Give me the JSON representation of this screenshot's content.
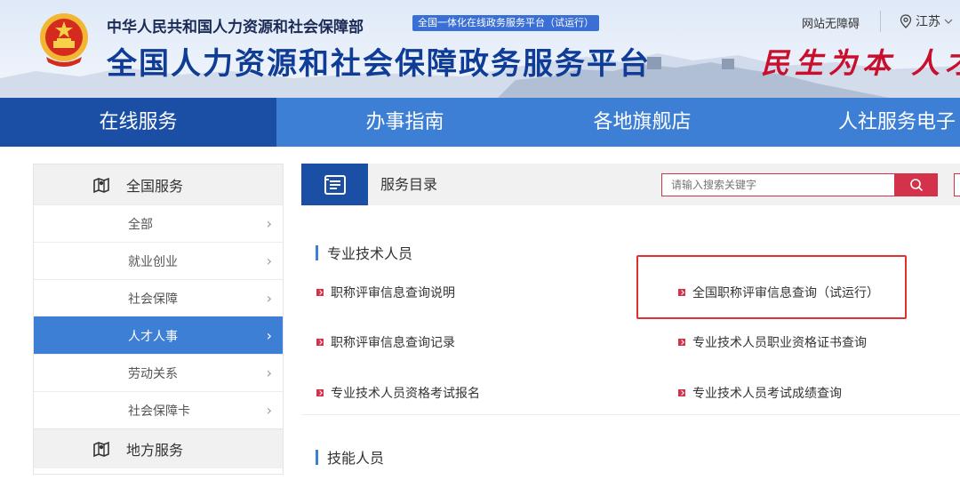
{
  "header": {
    "org_name": "中华人民共和国人力资源和社会保障部",
    "beta_badge": "全国一体化在线政务服务平台（试运行）",
    "site_title": "全国人力资源和社会保障政务服务平台",
    "barrier_free": "网站无障碍",
    "location": "江苏",
    "slogan": "民生为本 人才",
    "emblem_icon": "national-emblem-icon",
    "location_icon": "map-pin-icon"
  },
  "nav": {
    "items": [
      {
        "label": "在线服务",
        "active": true
      },
      {
        "label": "办事指南",
        "active": false
      },
      {
        "label": "各地旗舰店",
        "active": false
      },
      {
        "label": "人社服务电子",
        "active": false
      }
    ]
  },
  "sidebar": {
    "national_label": "全国服务",
    "local_label": "地方服务",
    "items": [
      {
        "label": "全部",
        "active": false
      },
      {
        "label": "就业创业",
        "active": false
      },
      {
        "label": "社会保障",
        "active": false
      },
      {
        "label": "人才人事",
        "active": true
      },
      {
        "label": "劳动关系",
        "active": false
      },
      {
        "label": "社会保障卡",
        "active": false
      }
    ]
  },
  "main": {
    "title": "服务目录",
    "search_placeholder": "请输入搜索关键字",
    "categories": [
      {
        "title": "专业技术人员",
        "services": [
          "职称评审信息查询说明",
          "全国职称评审信息查询（试运行）",
          "职称评审信息查询记录",
          "专业技术人员职业资格证书查询",
          "专业技术人员资格考试报名",
          "专业技术人员考试成绩查询"
        ]
      },
      {
        "title": "技能人员",
        "services": []
      }
    ]
  },
  "colors": {
    "primary_blue": "#3e7fd6",
    "dark_blue": "#1b4fa6",
    "accent_red": "#d4314b",
    "highlight_red": "#e03030"
  }
}
